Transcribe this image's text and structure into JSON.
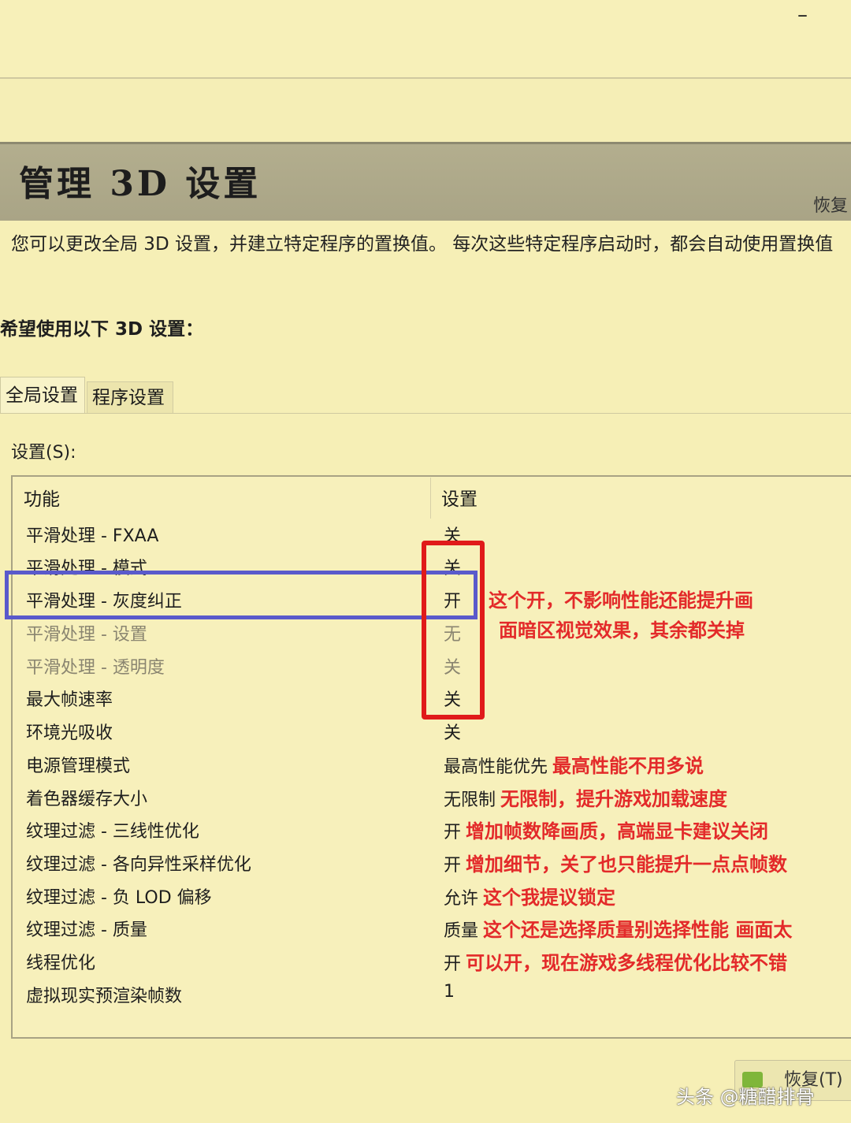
{
  "window": {
    "minimize_glyph": "–"
  },
  "header": {
    "title": "管理 3D 设置",
    "restore": "恢复"
  },
  "description": "您可以更改全局 3D 设置，并建立特定程序的置换值。 每次这些特定程序启动时，都会自动使用置换值",
  "want_label": "希望使用以下 3D 设置：",
  "tabs": [
    {
      "label": "全局设置"
    },
    {
      "label": "程序设置"
    }
  ],
  "settings_label": "设置(S):",
  "table": {
    "col_feature": "功能",
    "col_setting": "设置",
    "rows": [
      {
        "name": "平滑处理 - FXAA",
        "value": "关",
        "note": ""
      },
      {
        "name": "平滑处理 - 模式",
        "value": "关",
        "note": ""
      },
      {
        "name": "平滑处理 - 灰度纠正",
        "value": "开",
        "note": ""
      },
      {
        "name": "平滑处理 - 设置",
        "value": "无",
        "note": ""
      },
      {
        "name": "平滑处理 - 透明度",
        "value": "关",
        "note": ""
      },
      {
        "name": "最大帧速率",
        "value": "关",
        "note": ""
      },
      {
        "name": "环境光吸收",
        "value": "关",
        "note": ""
      },
      {
        "name": "电源管理模式",
        "value": "最高性能优先",
        "note": "最高性能不用多说"
      },
      {
        "name": "着色器缓存大小",
        "value": "无限制",
        "note": "无限制，提升游戏加载速度"
      },
      {
        "name": "纹理过滤 - 三线性优化",
        "value": "开",
        "note": "增加帧数降画质，高端显卡建议关闭"
      },
      {
        "name": "纹理过滤 - 各向异性采样优化",
        "value": "开",
        "note": "增加细节，关了也只能提升一点点帧数"
      },
      {
        "name": "纹理过滤 - 负 LOD 偏移",
        "value": "允许",
        "note": "这个我提议锁定"
      },
      {
        "name": "纹理过滤 - 质量",
        "value": "质量",
        "note": "这个还是选择质量别选择性能 画面太"
      },
      {
        "name": "线程优化",
        "value": "开",
        "note": "可以开，现在游戏多线程优化比较不错"
      },
      {
        "name": "虚拟现实预渲染帧数",
        "value": "1",
        "note": ""
      }
    ]
  },
  "annotation": {
    "gamma_line1": "这个开，不影响性能还能提升画",
    "gamma_line2": "面暗区视觉效果，其余都关掉",
    "highlight_blue": "#5a5acb",
    "highlight_red": "#e01a1a",
    "note_color": "#e32a2a"
  },
  "restore_button": "恢复(T)",
  "watermark": "头条 @糖醋排骨"
}
